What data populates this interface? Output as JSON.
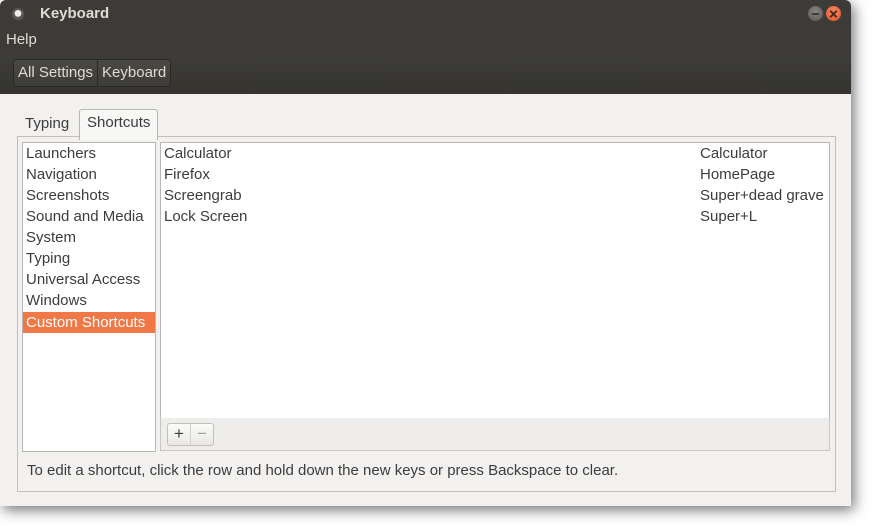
{
  "window": {
    "title": "Keyboard"
  },
  "menu": {
    "help": "Help"
  },
  "breadcrumbs": [
    "All Settings",
    "Keyboard"
  ],
  "tabs": {
    "typing": "Typing",
    "shortcuts": "Shortcuts"
  },
  "categories": [
    "Launchers",
    "Navigation",
    "Screenshots",
    "Sound and Media",
    "System",
    "Typing",
    "Universal Access",
    "Windows",
    "Custom Shortcuts"
  ],
  "selected_category": "Custom Shortcuts",
  "shortcuts": [
    {
      "name": "Calculator",
      "keys": "Calculator"
    },
    {
      "name": "Firefox",
      "keys": "HomePage"
    },
    {
      "name": "Screengrab",
      "keys": "Super+dead grave"
    },
    {
      "name": "Lock Screen",
      "keys": "Super+L"
    }
  ],
  "buttons": {
    "add": "+",
    "remove": "−"
  },
  "hint": "To edit a shortcut, click the row and hold down the new keys or press Backspace to clear.",
  "colors": {
    "accent": "#f07746",
    "titlebar": "#3c3b37",
    "background": "#f2f1f0"
  }
}
